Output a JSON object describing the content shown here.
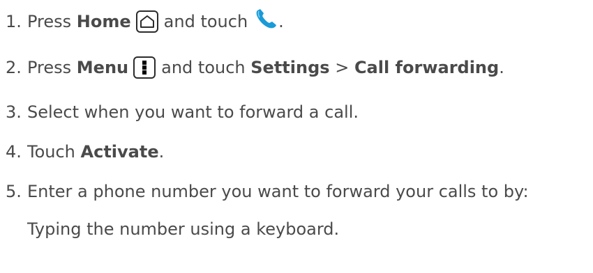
{
  "steps": [
    {
      "number": "1.",
      "parts": {
        "a": "Press ",
        "b": "Home",
        "c": " and touch ",
        "d": "."
      },
      "icons": [
        "home-key-icon",
        "phone-icon"
      ]
    },
    {
      "number": "2.",
      "parts": {
        "a": "Press ",
        "b": "Menu",
        "c": " and touch ",
        "d": "Settings",
        "e": " > ",
        "f": "Call forwarding",
        "g": "."
      },
      "icons": [
        "menu-key-icon"
      ]
    },
    {
      "number": "3.",
      "text": "Select when you want to forward a call."
    },
    {
      "number": "4.",
      "parts": {
        "a": "Touch ",
        "b": "Activate",
        "c": "."
      }
    },
    {
      "number": "5.",
      "text": "Enter a phone number you want to forward your calls to by:"
    }
  ],
  "sub_item": "Typing the number using a keyboard.",
  "colors": {
    "text": "#4a4a4a",
    "phone_icon": "#1a9bd7",
    "key_border": "#2b2b2b"
  }
}
